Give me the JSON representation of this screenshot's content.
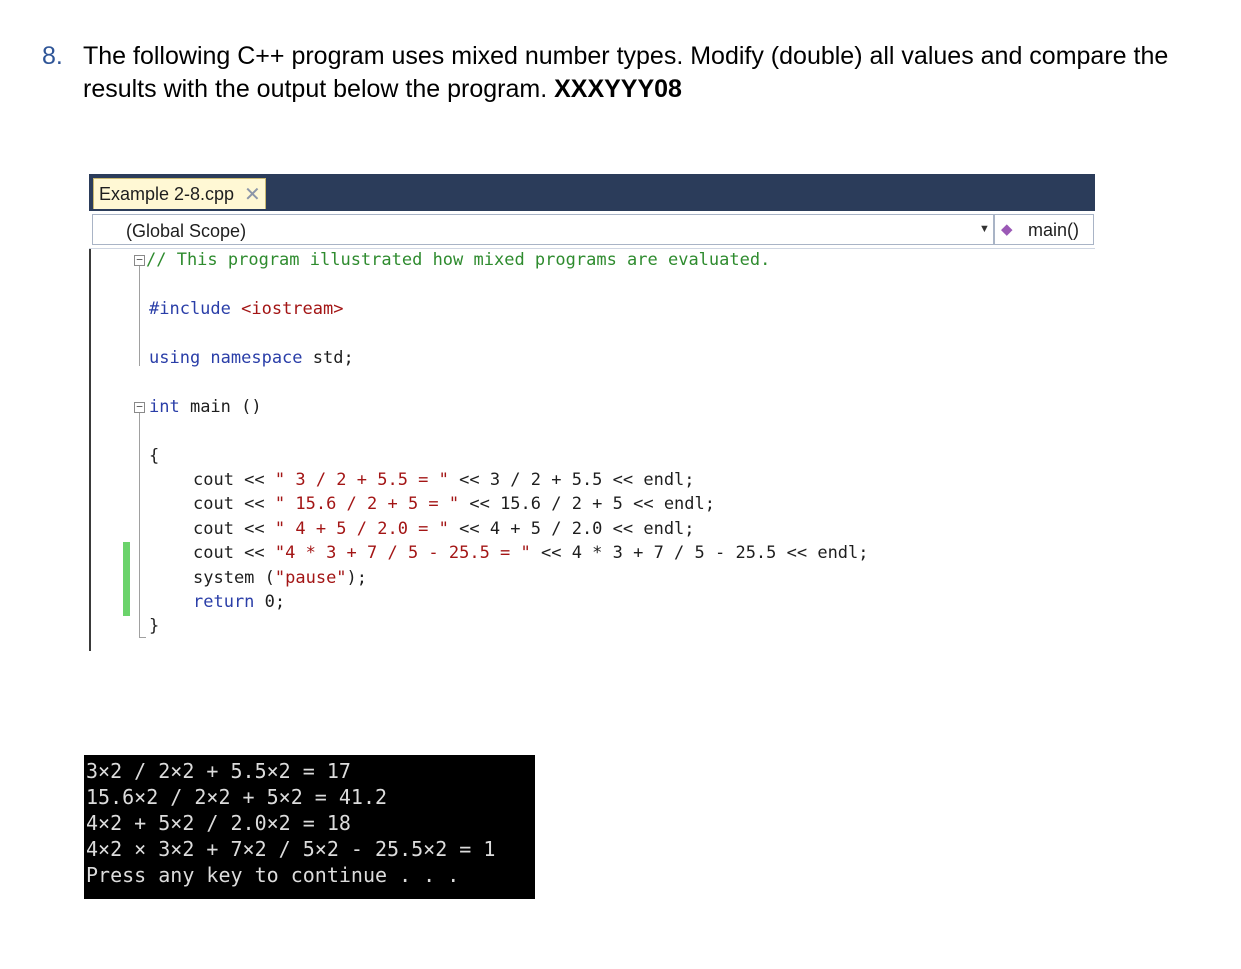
{
  "question": {
    "number": "8.",
    "text": "The following C++ program uses mixed number types. Modify (double)  all values and compare the results with the output below the program. ",
    "tag": "XXXYYY08"
  },
  "ide": {
    "tab_label": "Example 2-8.cpp",
    "tab_close": "✕",
    "scope": "(Global Scope)",
    "function": "main()",
    "code": {
      "comment": "// This program illustrated how mixed programs are evaluated.",
      "include_kw": "#include",
      "include_file": " <iostream>",
      "using_kw": "using namespace",
      "using_rest": " std;",
      "main_kw": "int",
      "main_rest": " main ()",
      "open_brace": "{",
      "l1_a": "cout << ",
      "l1_s": "\" 3 / 2 + 5.5 = \"",
      "l1_b": " << 3 / 2 + 5.5 << endl;",
      "l2_a": "cout << ",
      "l2_s": "\" 15.6 / 2 + 5 = \"",
      "l2_b": " << 15.6 / 2 + 5 << endl;",
      "l3_a": "cout << ",
      "l3_s": "\" 4 + 5 / 2.0 = \"",
      "l3_b": " << 4 + 5 / 2.0 << endl;",
      "l4_a": "cout << ",
      "l4_s": "\"4 * 3 + 7 / 5 - 25.5 = \"",
      "l4_b": " << 4 * 3 + 7 / 5 - 25.5 << endl;",
      "l5_a": "system (",
      "l5_s": "\"pause\"",
      "l5_b": ");",
      "l6_kw": "return",
      "l6_b": " 0;",
      "close_brace": "}"
    }
  },
  "console": {
    "lines": [
      "3×2 / 2×2 + 5.5×2 = 17",
      "15.6×2 / 2×2 + 5×2 = 41.2",
      "4×2 + 5×2 / 2.0×2 = 18",
      "4×2 × 3×2 + 7×2 / 5×2 - 25.5×2 = 1",
      "Press any key to continue . . ."
    ]
  }
}
